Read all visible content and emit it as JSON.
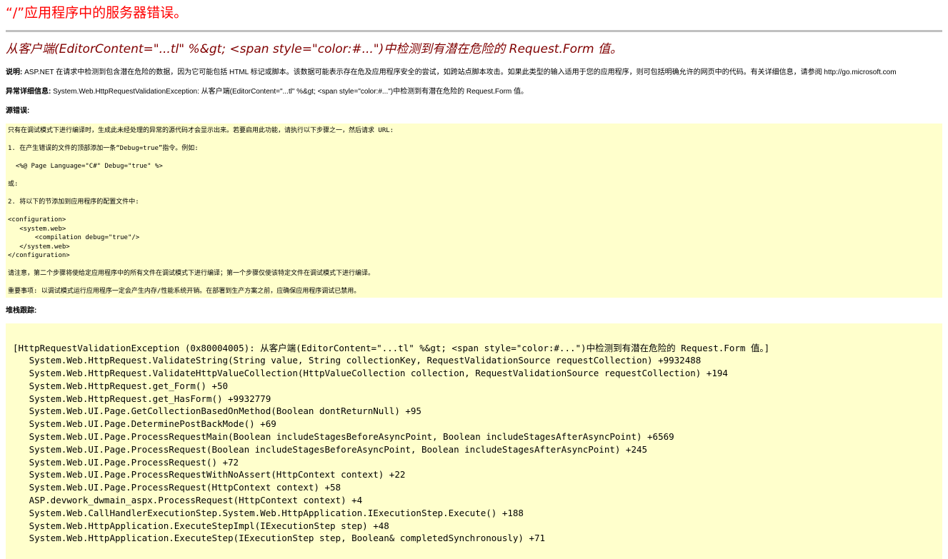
{
  "header": {
    "title": "“/”应用程序中的服务器错误。",
    "subtitle": "从客户端(EditorContent=\"...tl\" %&gt; <span style=\"color:#...\")中检测到有潜在危险的 Request.Form 值。"
  },
  "description": {
    "label": "说明:",
    "text": " ASP.NET 在请求中检测到包含潜在危险的数据，因为它可能包括 HTML 标记或脚本。该数据可能表示存在危及应用程序安全的尝试，如跨站点脚本攻击。如果此类型的输入适用于您的应用程序，则可包括明确允许的网页中的代码。有关详细信息，请参阅 http://go.microsoft.com"
  },
  "exception": {
    "label": "异常详细信息:",
    "text": " System.Web.HttpRequestValidationException: 从客户端(EditorContent=\"...tl\" %&gt; <span style=\"color:#...\")中检测到有潜在危险的 Request.Form 值。"
  },
  "source_error": {
    "label": "源错误:",
    "lines": [
      "只有在调试模式下进行编译时，生成此未经处理的异常的源代码才会显示出来。若要启用此功能，请执行以下步骤之一，然后请求 URL:",
      "1. 在产生错误的文件的顶部添加一条“Debug=true”指令。例如:",
      "  <%@ Page Language=\"C#\" Debug=\"true\" %>",
      "或:",
      "2. 将以下的节添加到应用程序的配置文件中:",
      "<configuration>\n   <system.web>\n       <compilation debug=\"true\"/>\n   </system.web>\n</configuration>",
      "请注意，第二个步骤将使给定应用程序中的所有文件在调试模式下进行编译；第一个步骤仅使该特定文件在调试模式下进行编译。",
      "重要事项: 以调试模式运行应用程序一定会产生内存/性能系统开销。在部署到生产方案之前，应确保应用程序调试已禁用。"
    ]
  },
  "stack_trace": {
    "label": "堆栈跟踪:",
    "lines": [
      "[HttpRequestValidationException (0x80004005): 从客户端(EditorContent=\"...tl\" %&gt; <span style=\"color:#...\")中检测到有潜在危险的 Request.Form 值。]",
      "   System.Web.HttpRequest.ValidateString(String value, String collectionKey, RequestValidationSource requestCollection) +9932488",
      "   System.Web.HttpRequest.ValidateHttpValueCollection(HttpValueCollection collection, RequestValidationSource requestCollection) +194",
      "   System.Web.HttpRequest.get_Form() +50",
      "   System.Web.HttpRequest.get_HasForm() +9932779",
      "   System.Web.UI.Page.GetCollectionBasedOnMethod(Boolean dontReturnNull) +95",
      "   System.Web.UI.Page.DeterminePostBackMode() +69",
      "   System.Web.UI.Page.ProcessRequestMain(Boolean includeStagesBeforeAsyncPoint, Boolean includeStagesAfterAsyncPoint) +6569",
      "   System.Web.UI.Page.ProcessRequest(Boolean includeStagesBeforeAsyncPoint, Boolean includeStagesAfterAsyncPoint) +245",
      "   System.Web.UI.Page.ProcessRequest() +72",
      "   System.Web.UI.Page.ProcessRequestWithNoAssert(HttpContext context) +22",
      "   System.Web.UI.Page.ProcessRequest(HttpContext context) +58",
      "   ASP.devwork_dwmain_aspx.ProcessRequest(HttpContext context) +4",
      "   System.Web.CallHandlerExecutionStep.System.Web.HttpApplication.IExecutionStep.Execute() +188",
      "   System.Web.HttpApplication.ExecuteStepImpl(IExecutionStep step) +48",
      "   System.Web.HttpApplication.ExecuteStep(IExecutionStep step, Boolean& completedSynchronously) +71"
    ]
  },
  "colors": {
    "title": "#ff0000",
    "subtitle": "#800000",
    "code_background": "#ffffcc",
    "rule": "#c0c0c0"
  }
}
